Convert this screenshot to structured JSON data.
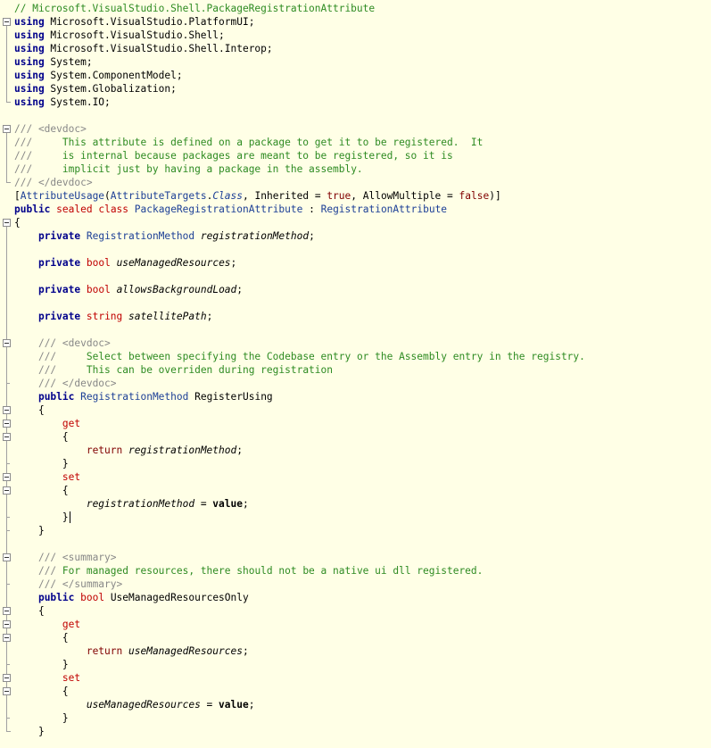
{
  "lines": [
    [
      [
        "com",
        "// Microsoft.VisualStudio.Shell.PackageRegistrationAttribute"
      ]
    ],
    [
      [
        "kw",
        "using"
      ],
      [
        "plain",
        " Microsoft.VisualStudio.PlatformUI;"
      ]
    ],
    [
      [
        "kw",
        "using"
      ],
      [
        "plain",
        " Microsoft.VisualStudio.Shell;"
      ]
    ],
    [
      [
        "kw",
        "using"
      ],
      [
        "plain",
        " Microsoft.VisualStudio.Shell.Interop;"
      ]
    ],
    [
      [
        "kw",
        "using"
      ],
      [
        "plain",
        " System;"
      ]
    ],
    [
      [
        "kw",
        "using"
      ],
      [
        "plain",
        " System.ComponentModel;"
      ]
    ],
    [
      [
        "kw",
        "using"
      ],
      [
        "plain",
        " System.Globalization;"
      ]
    ],
    [
      [
        "kw",
        "using"
      ],
      [
        "plain",
        " System.IO;"
      ]
    ],
    [],
    [
      [
        "doc",
        "/// <devdoc>"
      ]
    ],
    [
      [
        "doc",
        "///     "
      ],
      [
        "com",
        "This attribute is defined on a package to get it to be registered.  It"
      ]
    ],
    [
      [
        "doc",
        "///     "
      ],
      [
        "com",
        "is internal because packages are meant to be registered, so it is"
      ]
    ],
    [
      [
        "doc",
        "///     "
      ],
      [
        "com",
        "implicit just by having a package in the assembly."
      ]
    ],
    [
      [
        "doc",
        "/// </devdoc>"
      ]
    ],
    [
      [
        "plain",
        "["
      ],
      [
        "type",
        "AttributeUsage"
      ],
      [
        "plain",
        "("
      ],
      [
        "type",
        "AttributeTargets"
      ],
      [
        "plain",
        "."
      ],
      [
        "cls",
        "Class"
      ],
      [
        "plain",
        ", Inherited = "
      ],
      [
        "kw3",
        "true"
      ],
      [
        "plain",
        ", AllowMultiple = "
      ],
      [
        "kw3",
        "false"
      ],
      [
        "plain",
        ")]"
      ]
    ],
    [
      [
        "kw",
        "public"
      ],
      [
        "plain",
        " "
      ],
      [
        "kw2",
        "sealed"
      ],
      [
        "plain",
        " "
      ],
      [
        "kw2",
        "class"
      ],
      [
        "plain",
        " "
      ],
      [
        "type",
        "PackageRegistrationAttribute"
      ],
      [
        "plain",
        " : "
      ],
      [
        "type",
        "RegistrationAttribute"
      ]
    ],
    [
      [
        "plain",
        "{"
      ]
    ],
    [
      [
        "plain",
        "    "
      ],
      [
        "kw",
        "private"
      ],
      [
        "plain",
        " "
      ],
      [
        "type",
        "RegistrationMethod"
      ],
      [
        "plain",
        " "
      ],
      [
        "it",
        "registrationMethod"
      ],
      [
        "plain",
        ";"
      ]
    ],
    [],
    [
      [
        "plain",
        "    "
      ],
      [
        "kw",
        "private"
      ],
      [
        "plain",
        " "
      ],
      [
        "kw2",
        "bool"
      ],
      [
        "plain",
        " "
      ],
      [
        "it",
        "useManagedResources"
      ],
      [
        "plain",
        ";"
      ]
    ],
    [],
    [
      [
        "plain",
        "    "
      ],
      [
        "kw",
        "private"
      ],
      [
        "plain",
        " "
      ],
      [
        "kw2",
        "bool"
      ],
      [
        "plain",
        " "
      ],
      [
        "it",
        "allowsBackgroundLoad"
      ],
      [
        "plain",
        ";"
      ]
    ],
    [],
    [
      [
        "plain",
        "    "
      ],
      [
        "kw",
        "private"
      ],
      [
        "plain",
        " "
      ],
      [
        "kw2",
        "string"
      ],
      [
        "plain",
        " "
      ],
      [
        "it",
        "satellitePath"
      ],
      [
        "plain",
        ";"
      ]
    ],
    [],
    [
      [
        "plain",
        "    "
      ],
      [
        "doc",
        "/// <devdoc>"
      ]
    ],
    [
      [
        "plain",
        "    "
      ],
      [
        "doc",
        "///     "
      ],
      [
        "com",
        "Select between specifying the Codebase entry or the Assembly entry in the registry."
      ]
    ],
    [
      [
        "plain",
        "    "
      ],
      [
        "doc",
        "///     "
      ],
      [
        "com",
        "This can be overriden during registration"
      ]
    ],
    [
      [
        "plain",
        "    "
      ],
      [
        "doc",
        "/// </devdoc>"
      ]
    ],
    [
      [
        "plain",
        "    "
      ],
      [
        "kw",
        "public"
      ],
      [
        "plain",
        " "
      ],
      [
        "type",
        "RegistrationMethod"
      ],
      [
        "plain",
        " RegisterUsing"
      ]
    ],
    [
      [
        "plain",
        "    {"
      ]
    ],
    [
      [
        "plain",
        "        "
      ],
      [
        "kw2",
        "get"
      ]
    ],
    [
      [
        "plain",
        "        {"
      ]
    ],
    [
      [
        "plain",
        "            "
      ],
      [
        "kw3",
        "return"
      ],
      [
        "plain",
        " "
      ],
      [
        "it",
        "registrationMethod"
      ],
      [
        "plain",
        ";"
      ]
    ],
    [
      [
        "plain",
        "        }"
      ]
    ],
    [
      [
        "plain",
        "        "
      ],
      [
        "kw2",
        "set"
      ]
    ],
    [
      [
        "plain",
        "        {"
      ]
    ],
    [
      [
        "plain",
        "            "
      ],
      [
        "it",
        "registrationMethod"
      ],
      [
        "plain",
        " = "
      ],
      [
        "val",
        "value"
      ],
      [
        "plain",
        ";"
      ]
    ],
    [
      [
        "plain",
        "        }"
      ]
    ],
    [
      [
        "plain",
        "    }"
      ]
    ],
    [],
    [
      [
        "plain",
        "    "
      ],
      [
        "doc",
        "/// <summary>"
      ]
    ],
    [
      [
        "plain",
        "    "
      ],
      [
        "doc",
        "/// "
      ],
      [
        "com",
        "For managed resources, there should not be a native ui dll registered."
      ]
    ],
    [
      [
        "plain",
        "    "
      ],
      [
        "doc",
        "/// </summary>"
      ]
    ],
    [
      [
        "plain",
        "    "
      ],
      [
        "kw",
        "public"
      ],
      [
        "plain",
        " "
      ],
      [
        "kw2",
        "bool"
      ],
      [
        "plain",
        " UseManagedResourcesOnly"
      ]
    ],
    [
      [
        "plain",
        "    {"
      ]
    ],
    [
      [
        "plain",
        "        "
      ],
      [
        "kw2",
        "get"
      ]
    ],
    [
      [
        "plain",
        "        {"
      ]
    ],
    [
      [
        "plain",
        "            "
      ],
      [
        "kw3",
        "return"
      ],
      [
        "plain",
        " "
      ],
      [
        "it",
        "useManagedResources"
      ],
      [
        "plain",
        ";"
      ]
    ],
    [
      [
        "plain",
        "        }"
      ]
    ],
    [
      [
        "plain",
        "        "
      ],
      [
        "kw2",
        "set"
      ]
    ],
    [
      [
        "plain",
        "        {"
      ]
    ],
    [
      [
        "plain",
        "            "
      ],
      [
        "it",
        "useManagedResources"
      ],
      [
        "plain",
        " = "
      ],
      [
        "val",
        "value"
      ],
      [
        "plain",
        ";"
      ]
    ],
    [
      [
        "plain",
        "        }"
      ]
    ],
    [
      [
        "plain",
        "    }"
      ]
    ]
  ],
  "colors": {
    "background": "#ffffe6",
    "keyword": "#00008b",
    "keyword_red": "#c00000",
    "type": "#1c3f96",
    "comment": "#2e8b22",
    "doc_tag": "#888888"
  }
}
